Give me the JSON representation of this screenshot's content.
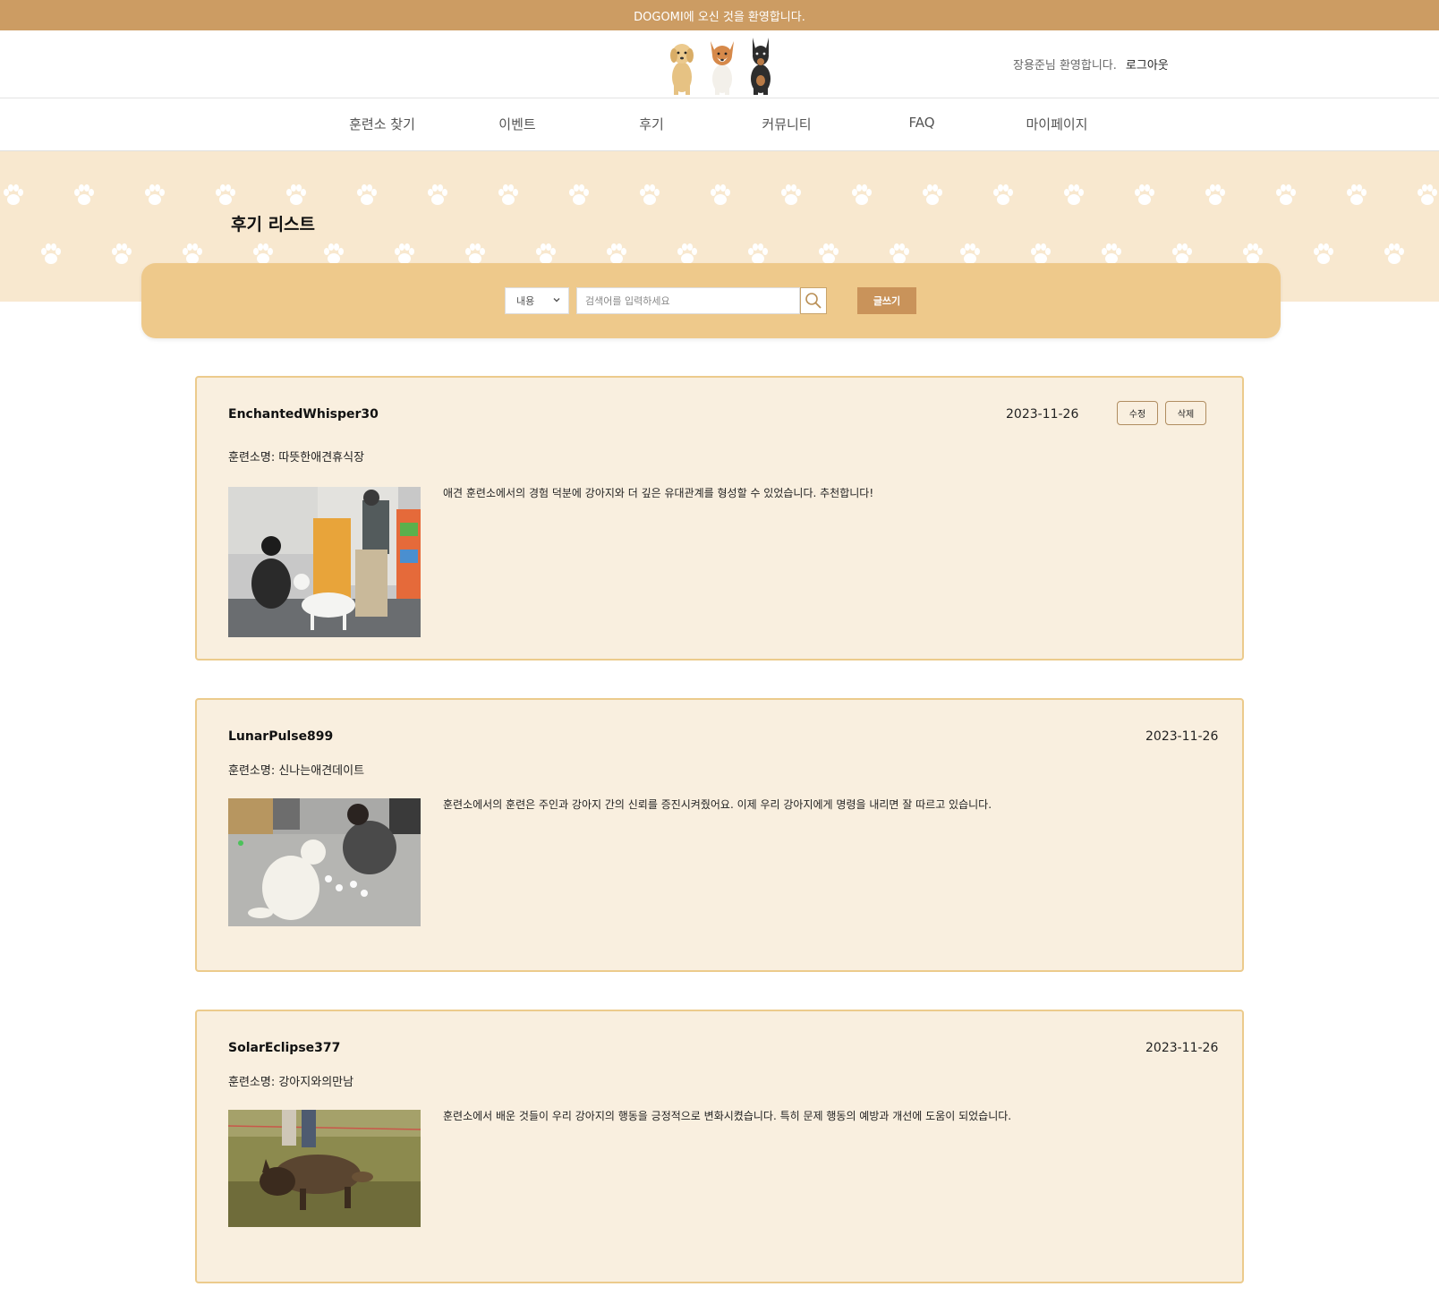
{
  "topbar": {
    "welcome": "DOGOMI에 오신 것을 환영합니다."
  },
  "header": {
    "greeting": "장용준님 환영합니다.",
    "logout": "로그아웃"
  },
  "nav": {
    "items": [
      "훈련소 찾기",
      "이벤트",
      "후기",
      "커뮤니티",
      "FAQ",
      "마이페이지"
    ]
  },
  "page": {
    "title": "후기 리스트"
  },
  "search": {
    "select_value": "내용",
    "placeholder": "검색어를 입력하세요",
    "write_label": "글쓰기"
  },
  "reviews": [
    {
      "user": "EnchantedWhisper30",
      "date": "2023-11-26",
      "center": "훈련소명: 따뜻한애견휴식장",
      "text": "애견 훈련소에서의 경험 덕분에 강아지와 더 깊은 유대관계를 형성할 수 있었습니다. 추천합니다!",
      "edit_label": "수정",
      "delete_label": "삭제"
    },
    {
      "user": "LunarPulse899",
      "date": "2023-11-26",
      "center": "훈련소명: 신나는애견데이트",
      "text": "훈련소에서의 훈련은 주인과 강아지 간의 신뢰를 증진시켜줬어요. 이제 우리 강아지에게 명령을 내리면 잘 따르고 있습니다."
    },
    {
      "user": "SolarEclipse377",
      "date": "2023-11-26",
      "center": "훈련소명: 강아지와의만남",
      "text": "훈련소에서 배운 것들이 우리 강아지의 행동을 긍정적으로 변화시켰습니다. 특히 문제 행동의 예방과 개선에 도움이 되었습니다."
    }
  ],
  "colors": {
    "topbar": "#cc9c63",
    "hero": "#f8e8cf",
    "panel": "#eec98b",
    "card_bg": "#f9efdf",
    "card_border": "#eccb8c",
    "button": "#c9935a"
  },
  "icons": {
    "search": "search-icon",
    "select": "chevron-down-icon",
    "paw": "paw-icon",
    "logo": "dogs-logo"
  }
}
